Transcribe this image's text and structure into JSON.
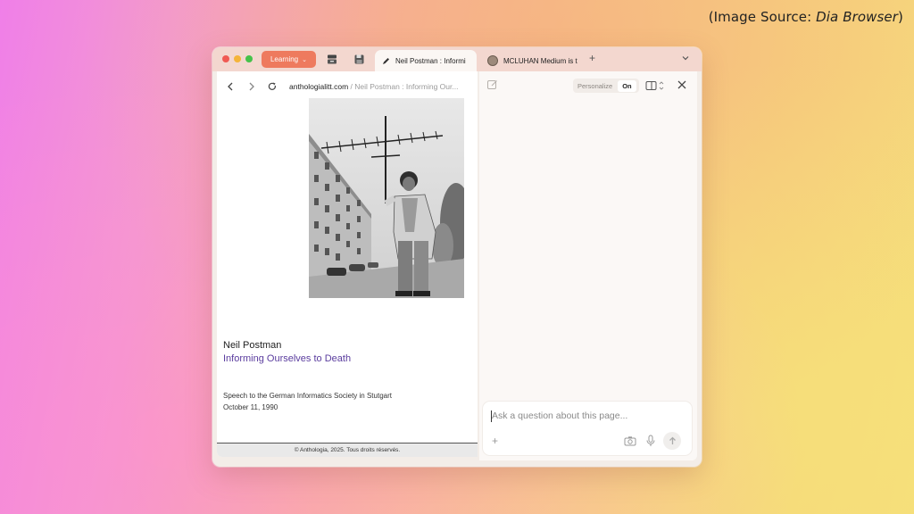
{
  "credit": {
    "prefix": "(Image Source: ",
    "source": "Dia Browser",
    "suffix": ")"
  },
  "titlebar": {
    "space_label": "Learning",
    "tabs": [
      {
        "label": "Neil Postman : Informi",
        "active": true
      },
      {
        "label": "MCLUHAN Medium is t",
        "active": false
      }
    ],
    "new_tab": "+"
  },
  "address": {
    "domain": "anthologialitt.com",
    "separator": " / ",
    "path": "Neil Postman : Informing Our..."
  },
  "page": {
    "author": "Neil Postman",
    "title": "Informing Ourselves to Death",
    "speech": "Speech to the German Informatics Society in Stutgart",
    "date": "October 11, 1990",
    "footer": "© Anthologia, 2025. Tous droits réservés."
  },
  "assistant": {
    "personalize_label": "Personalize",
    "personalize_state": "On",
    "input_placeholder": "Ask a question about this page...",
    "add_label": "+"
  },
  "colors": {
    "accent_space": "#ee7a5e",
    "link_title": "#5a3c9e",
    "titlebar": "#f3d7cf"
  }
}
